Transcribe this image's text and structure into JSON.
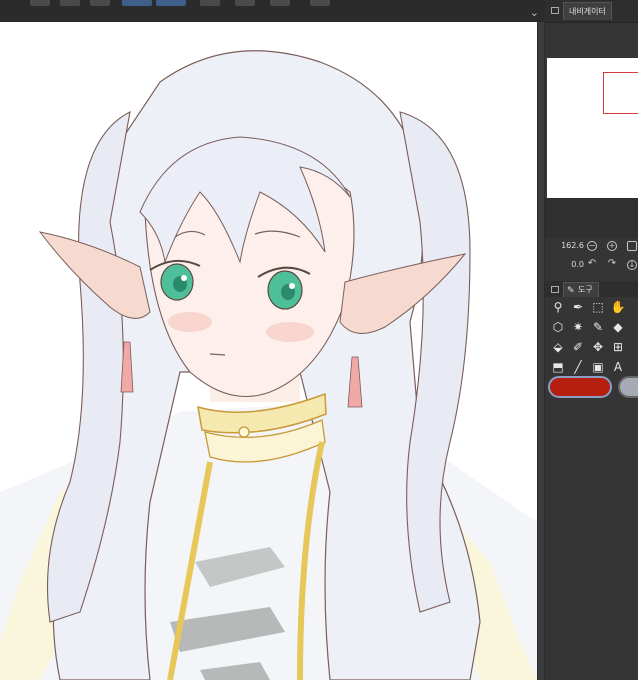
{
  "toolbar": {
    "chevron_icon": "chevron-down-icon"
  },
  "navigator": {
    "tab_label": "내비게이터",
    "zoom_value": "162.6",
    "rotation_value": "0.0"
  },
  "tool_panel": {
    "tab_label": "도구",
    "tools": [
      {
        "name": "zoom-icon",
        "glyph": "⚲"
      },
      {
        "name": "eyedropper-icon",
        "glyph": "✒"
      },
      {
        "name": "selection-icon",
        "glyph": "⬚"
      },
      {
        "name": "hand-icon",
        "glyph": "✋"
      },
      {
        "name": "cube-icon",
        "glyph": "⬡"
      },
      {
        "name": "magic-wand-icon",
        "glyph": "✷"
      },
      {
        "name": "pen-icon",
        "glyph": "✎"
      },
      {
        "name": "eraser-icon",
        "glyph": "◆"
      },
      {
        "name": "fill-icon",
        "glyph": "⬙"
      },
      {
        "name": "brush-icon",
        "glyph": "✐"
      },
      {
        "name": "move-icon",
        "glyph": "✥"
      },
      {
        "name": "grid-icon",
        "glyph": "⊞"
      },
      {
        "name": "frame-icon",
        "glyph": "⬒"
      },
      {
        "name": "line-icon",
        "glyph": "╱"
      },
      {
        "name": "gradient-icon",
        "glyph": "▣"
      },
      {
        "name": "text-icon",
        "glyph": "A"
      }
    ]
  },
  "colors": {
    "main": "#b51f10",
    "sub": "#a6aab4",
    "accent": "#3f5e8c"
  }
}
